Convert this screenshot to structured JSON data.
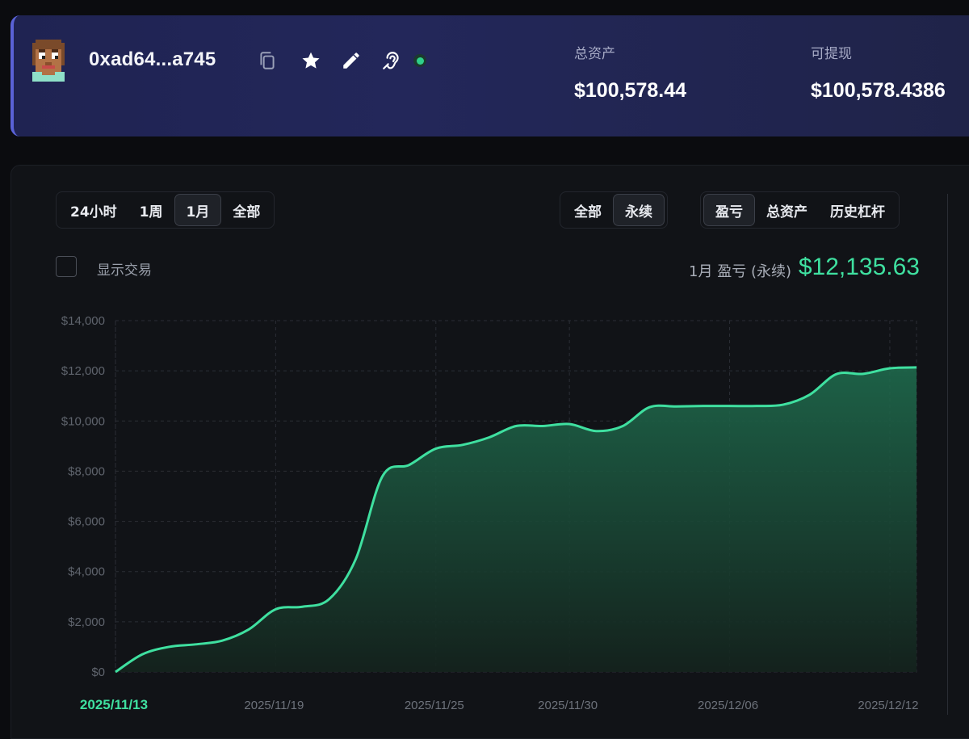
{
  "header": {
    "address": "0xad64...a745",
    "icons": [
      "copy-icon",
      "star-icon",
      "pencil-icon",
      "ear-icon"
    ],
    "total_assets_label": "总资产",
    "total_assets_value": "$100,578.44",
    "withdrawable_label": "可提现",
    "withdrawable_value": "$100,578.4386"
  },
  "range_tabs": [
    "24小时",
    "1周",
    "1月",
    "全部"
  ],
  "range_active": "1月",
  "market_tabs": [
    "全部",
    "永续"
  ],
  "market_active": "永续",
  "metric_tabs": [
    "盈亏",
    "总资产",
    "历史杠杆"
  ],
  "metric_active": "盈亏",
  "show_trades_label": "显示交易",
  "pnl": {
    "caption": "1月 盈亏 (永续)",
    "value": "$12,135.63"
  },
  "colors": {
    "accent": "#3fe0a0",
    "header_bg": "#23275a",
    "panel_bg": "#111317"
  },
  "chart_data": {
    "type": "area",
    "title": "",
    "xlabel": "",
    "ylabel": "",
    "ylim": [
      0,
      14000
    ],
    "y_ticks": [
      "$0",
      "$2,000",
      "$4,000",
      "$6,000",
      "$8,000",
      "$10,000",
      "$12,000",
      "$14,000"
    ],
    "x_ticks": [
      "2025/11/13",
      "2025/11/19",
      "2025/11/25",
      "2025/11/30",
      "2025/12/06",
      "2025/12/12"
    ],
    "x_active": "2025/11/13",
    "x_range": [
      "2025/11/13",
      "2025/12/13"
    ],
    "grid": true,
    "series": [
      {
        "values": [
          [
            "2025/11/13",
            0
          ],
          [
            "2025/11/14",
            700
          ],
          [
            "2025/11/15",
            1000
          ],
          [
            "2025/11/16",
            1100
          ],
          [
            "2025/11/17",
            1250
          ],
          [
            "2025/11/18",
            1700
          ],
          [
            "2025/11/19",
            2500
          ],
          [
            "2025/11/20",
            2600
          ],
          [
            "2025/11/21",
            2900
          ],
          [
            "2025/11/22",
            4500
          ],
          [
            "2025/11/23",
            7800
          ],
          [
            "2025/11/24",
            8250
          ],
          [
            "2025/11/25",
            8900
          ],
          [
            "2025/11/26",
            9050
          ],
          [
            "2025/11/27",
            9350
          ],
          [
            "2025/11/28",
            9800
          ],
          [
            "2025/11/29",
            9800
          ],
          [
            "2025/11/30",
            9880
          ],
          [
            "2025/12/01",
            9600
          ],
          [
            "2025/12/02",
            9800
          ],
          [
            "2025/12/03",
            10550
          ],
          [
            "2025/12/04",
            10580
          ],
          [
            "2025/12/05",
            10600
          ],
          [
            "2025/12/06",
            10600
          ],
          [
            "2025/12/07",
            10600
          ],
          [
            "2025/12/08",
            10650
          ],
          [
            "2025/12/09",
            11050
          ],
          [
            "2025/12/10",
            11870
          ],
          [
            "2025/12/11",
            11880
          ],
          [
            "2025/12/12",
            12100
          ],
          [
            "2025/12/13",
            12135.63
          ]
        ]
      }
    ]
  }
}
